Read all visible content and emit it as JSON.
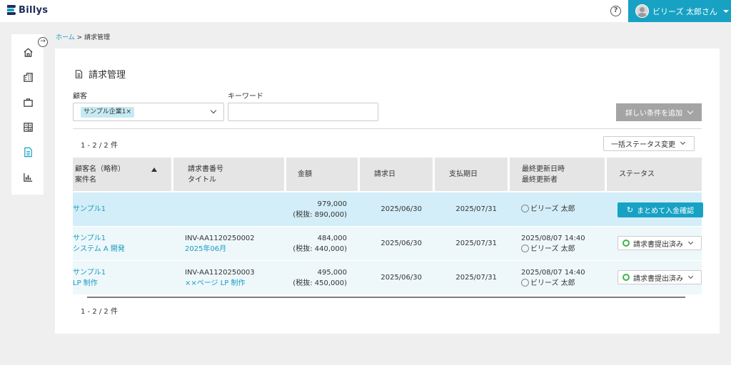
{
  "header": {
    "app_name": "Billys",
    "help_icon": "?",
    "user_name": "ビリーズ 太郎さん",
    "accent_color": "#17a2c4"
  },
  "sidebar": {
    "items": [
      {
        "icon": "home-icon"
      },
      {
        "icon": "building-icon"
      },
      {
        "icon": "briefcase-icon"
      },
      {
        "icon": "calculator-icon"
      },
      {
        "icon": "invoice-icon",
        "active": true
      },
      {
        "icon": "chart-icon"
      }
    ],
    "toggle_icon": "→"
  },
  "breadcrumb": {
    "home": "ホーム",
    "separator": " > ",
    "current": "請求管理"
  },
  "page": {
    "title": "請求管理"
  },
  "filters": {
    "customer_label": "顧客",
    "customer_chip": "サンプル企業1",
    "chip_remove": "×",
    "keyword_label": "キーワード",
    "keyword_value": "",
    "advanced_button": "詳しい条件を追加"
  },
  "results": {
    "count_top": "1 - 2 / 2 件",
    "count_bottom": "1 - 2 / 2 件",
    "bulk_status_button": "一括ステータス変更"
  },
  "table": {
    "headers": [
      {
        "line1": "顧客名（略称）",
        "line2": "案件名",
        "sorted": "asc"
      },
      {
        "line1": "請求書番号",
        "line2": "タイトル"
      },
      {
        "line1": "金額",
        "line2": ""
      },
      {
        "line1": "請求日",
        "line2": ""
      },
      {
        "line1": "支払期日",
        "line2": ""
      },
      {
        "line1": "最終更新日時",
        "line2": "最終更新者"
      },
      {
        "line1": "ステータス",
        "line2": ""
      }
    ],
    "rows": [
      {
        "customer": "サンプル1",
        "project": "",
        "invoice_no": "",
        "title": "",
        "amount": "979,000",
        "amount_tax": "(税抜: 890,000)",
        "invoice_date": "2025/06/30",
        "due_date": "2025/07/31",
        "updated_at": "",
        "updated_by": "ビリーズ 太郎",
        "status_button": "まとめて入金確認"
      },
      {
        "customer": "サンプル1",
        "project": "システム A 開発",
        "invoice_no": "INV-AA1120250002",
        "title": "2025年06月",
        "amount": "484,000",
        "amount_tax": "(税抜: 440,000)",
        "invoice_date": "2025/06/30",
        "due_date": "2025/07/31",
        "updated_at": "2025/08/07 14:40",
        "updated_by": "ビリーズ 太郎",
        "status": "請求書提出済み"
      },
      {
        "customer": "サンプル1",
        "project": "LP 制作",
        "invoice_no": "INV-AA1120250003",
        "title": "××ページ LP 制作",
        "amount": "495,000",
        "amount_tax": "(税抜: 450,000)",
        "invoice_date": "2025/06/30",
        "due_date": "2025/07/31",
        "updated_at": "2025/08/07 14:40",
        "updated_by": "ビリーズ 太郎",
        "status": "請求書提出済み"
      }
    ]
  }
}
